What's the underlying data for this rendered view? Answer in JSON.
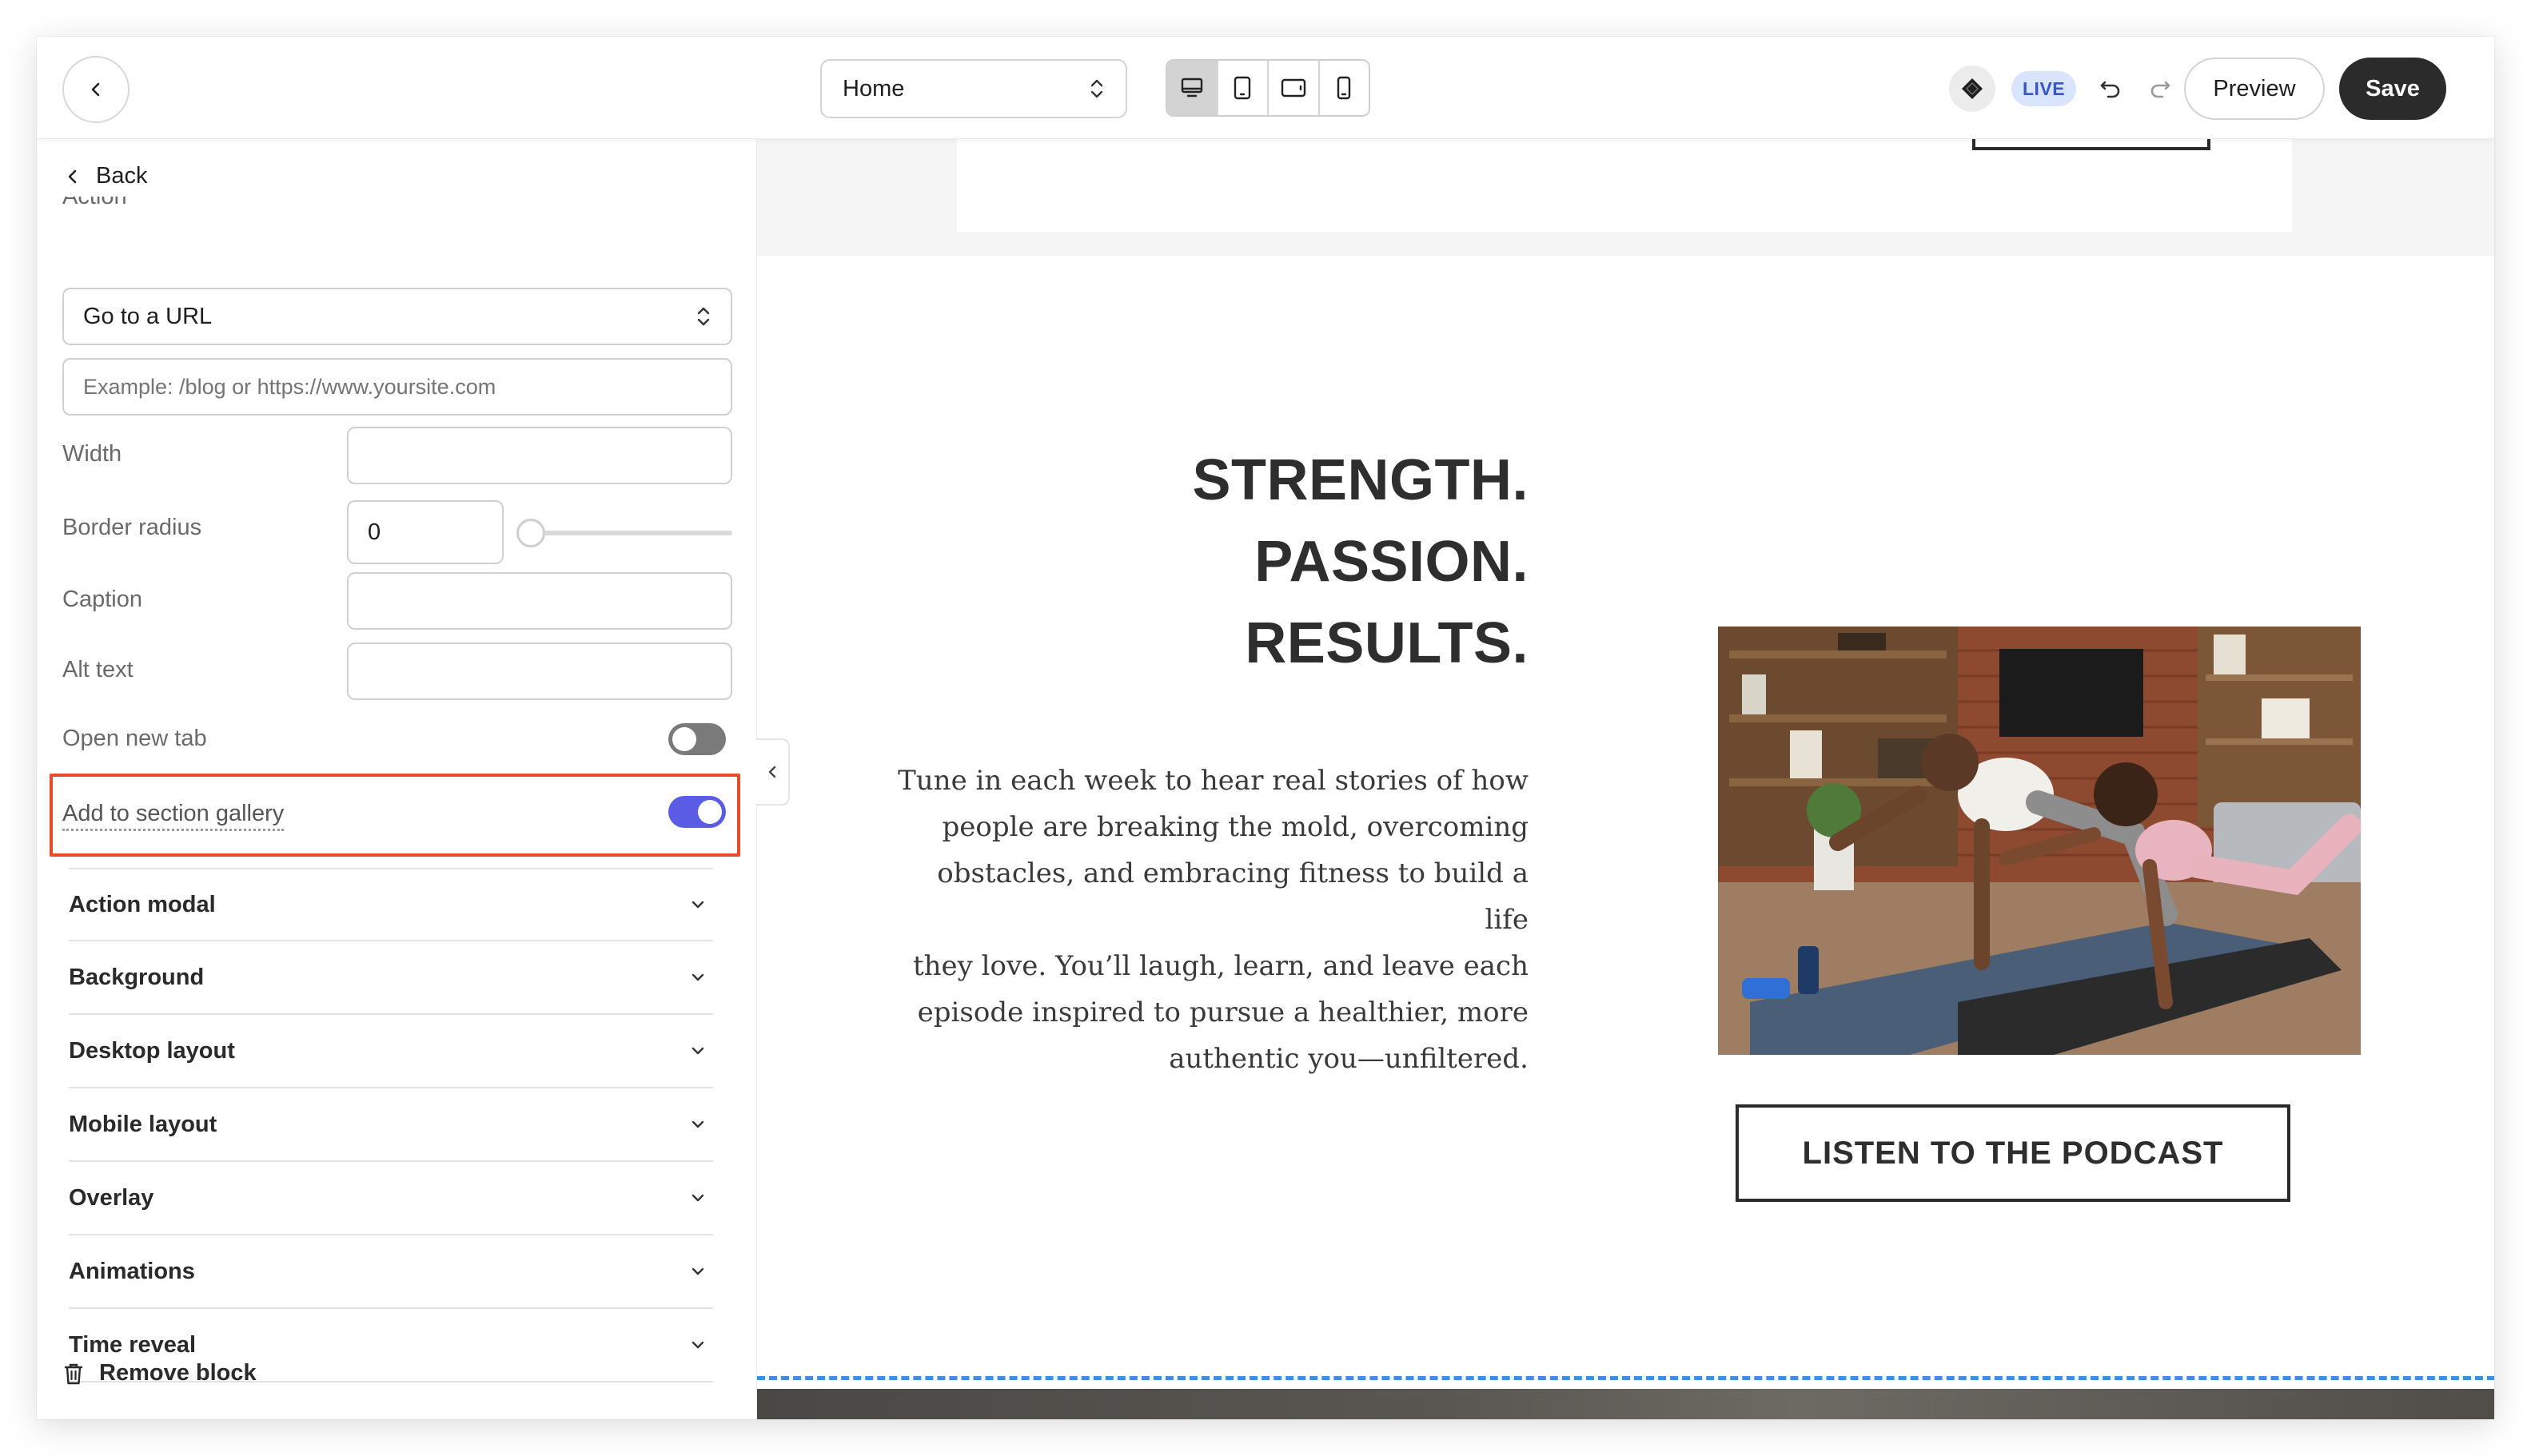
{
  "topbar": {
    "page_select": "Home",
    "live_badge": "LIVE",
    "preview_label": "Preview",
    "save_label": "Save",
    "device_modes": [
      "desktop",
      "tablet-portrait",
      "tablet-landscape",
      "mobile"
    ],
    "active_device": "desktop"
  },
  "panel": {
    "back_label": "Back",
    "cut_label": "Action",
    "action_select": "Go to a URL",
    "url_placeholder": "Example: /blog or https://www.yoursite.com",
    "fields": {
      "width_label": "Width",
      "border_radius_label": "Border radius",
      "border_radius_value": "0",
      "caption_label": "Caption",
      "alt_text_label": "Alt text",
      "open_new_tab_label": "Open new tab",
      "open_new_tab_on": false,
      "add_to_gallery_label": "Add to section gallery",
      "add_to_gallery_on": true
    },
    "accordions": [
      "Action modal",
      "Background",
      "Desktop layout",
      "Mobile layout",
      "Overlay",
      "Animations",
      "Time reveal"
    ],
    "remove_label": "Remove block"
  },
  "canvas": {
    "headline": [
      "STRENGTH.",
      "PASSION.",
      "RESULTS."
    ],
    "body_lines": [
      "Tune in each week to hear real stories of how",
      "people are breaking the mold, overcoming",
      "obstacles, and embracing fitness to build a life",
      "they love. You’ll laugh, learn, and leave each",
      "episode inspired to pursue a healthier, more",
      "authentic you—unfiltered."
    ],
    "cta_label": "LISTEN TO THE PODCAST"
  },
  "colors": {
    "accent_toggle": "#5b5ce6",
    "highlight": "#e94a2a",
    "save_bg": "#2b2b2b",
    "live_bg": "#d9e4ff",
    "live_text": "#3856c8",
    "dashed": "#3d8ee8"
  }
}
